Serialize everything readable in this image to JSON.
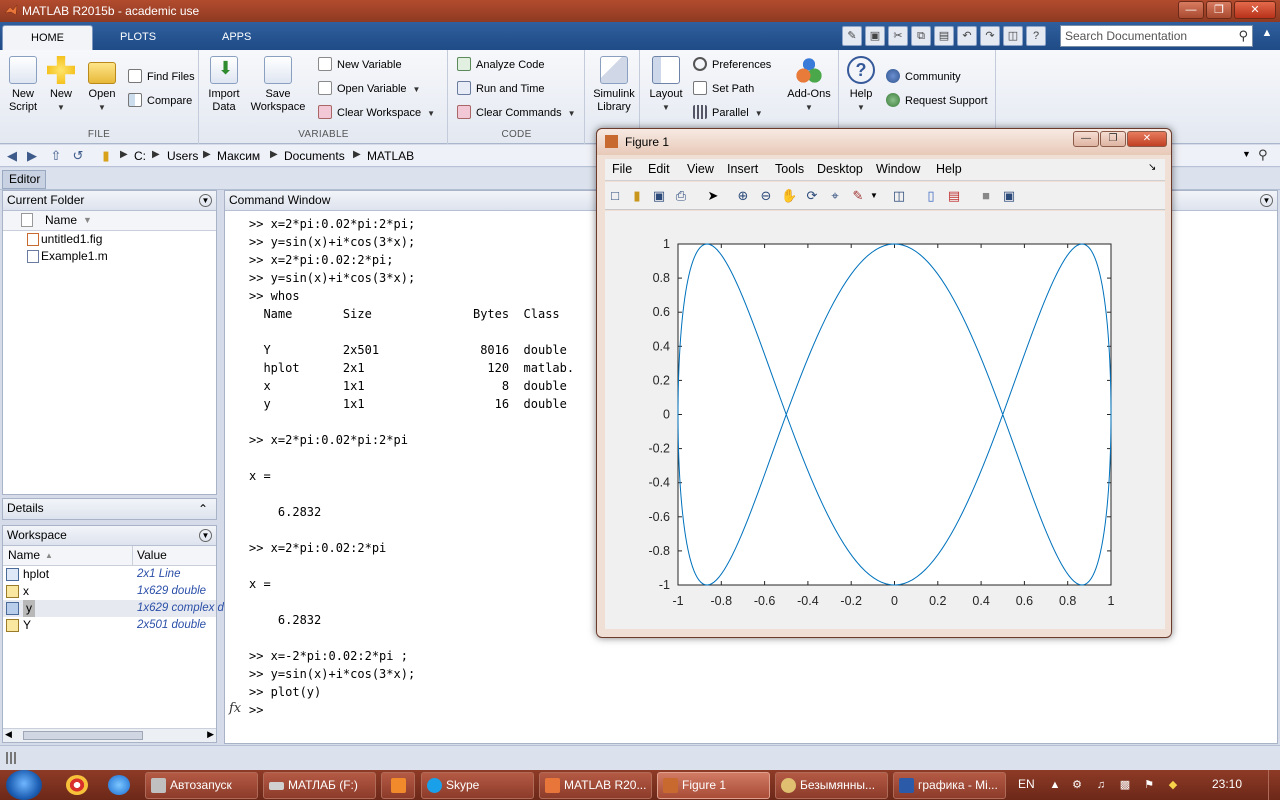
{
  "window": {
    "title": "MATLAB R2015b - academic use"
  },
  "tabs": [
    {
      "label": "HOME"
    },
    {
      "label": "PLOTS"
    },
    {
      "label": "APPS"
    }
  ],
  "search": {
    "placeholder": "Search Documentation"
  },
  "ribbon": {
    "file": {
      "label": "FILE",
      "new_script": [
        "New",
        "Script"
      ],
      "new": "New",
      "open": "Open",
      "find_files": "Find Files",
      "compare": "Compare"
    },
    "variable": {
      "label": "VARIABLE",
      "import_data": [
        "Import",
        "Data"
      ],
      "save_workspace": [
        "Save",
        "Workspace"
      ],
      "new_variable": "New Variable",
      "open_variable": "Open Variable",
      "clear_workspace": "Clear Workspace"
    },
    "code": {
      "label": "CODE",
      "analyze_code": "Analyze Code",
      "run_and_time": "Run and Time",
      "clear_commands": "Clear Commands"
    },
    "simulink": [
      "Simulink",
      "Library"
    ],
    "environment": {
      "layout": "Layout",
      "preferences": "Preferences",
      "set_path": "Set Path",
      "parallel": "Parallel",
      "addons": "Add-Ons"
    },
    "resources": {
      "help": "Help",
      "community": "Community",
      "request_support": "Request Support"
    }
  },
  "address": {
    "path": [
      "C:",
      "Users",
      "Максим",
      "Documents",
      "MATLAB"
    ]
  },
  "editor_tab": "Editor",
  "current_folder": {
    "title": "Current Folder",
    "column_name": "Name",
    "files": [
      {
        "name": "untitled1.fig"
      },
      {
        "name": "Example1.m"
      }
    ]
  },
  "details": {
    "title": "Details"
  },
  "workspace": {
    "title": "Workspace",
    "col_name": "Name",
    "col_value": "Value",
    "vars": [
      {
        "name": "hplot",
        "value": "2x1 Line"
      },
      {
        "name": "x",
        "value": "1x629 double"
      },
      {
        "name": "y",
        "value": "1x629 complex d"
      },
      {
        "name": "Y",
        "value": "2x501 double"
      }
    ]
  },
  "command_window": {
    "title": "Command Window",
    "lines": [
      ">> x=2*pi:0.02*pi:2*pi;",
      ">> y=sin(x)+i*cos(3*x);",
      ">> x=2*pi:0.02:2*pi;",
      ">> y=sin(x)+i*cos(3*x);",
      ">> whos",
      "  Name       Size              Bytes  Class",
      "",
      "  Y          2x501              8016  double",
      "  hplot      2x1                 120  matlab.",
      "  x          1x1                   8  double",
      "  y          1x1                  16  double",
      "",
      ">> x=2*pi:0.02*pi:2*pi",
      "",
      "x =",
      "",
      "    6.2832",
      "",
      ">> x=2*pi:0.02:2*pi",
      "",
      "x =",
      "",
      "    6.2832",
      "",
      ">> x=-2*pi:0.02:2*pi ;",
      ">> y=sin(x)+i*cos(3*x);",
      ">> plot(y)",
      ">>"
    ],
    "fx": "fx"
  },
  "figure": {
    "title": "Figure 1",
    "menu": [
      "File",
      "Edit",
      "View",
      "Insert",
      "Tools",
      "Desktop",
      "Window",
      "Help"
    ]
  },
  "chart_data": {
    "type": "line",
    "function": "plot(sin(x) + i*cos(3*x)), x = -2*pi:0.02:2*pi",
    "x_range": [
      -6.2832,
      6.2832
    ],
    "x_step": 0.02,
    "series": [
      {
        "real": "sin(x)",
        "imag": "cos(3*x)",
        "color": "#0072bd"
      }
    ],
    "xlim": [
      -1,
      1
    ],
    "ylim": [
      -1,
      1
    ],
    "xticks": [
      "-1",
      "-0.8",
      "-0.6",
      "-0.4",
      "-0.2",
      "0",
      "0.2",
      "0.4",
      "0.6",
      "0.8",
      "1"
    ],
    "yticks": [
      "1",
      "0.8",
      "0.6",
      "0.4",
      "0.2",
      "0",
      "-0.2",
      "-0.4",
      "-0.6",
      "-0.8",
      "-1"
    ],
    "grid": false
  },
  "taskbar": {
    "tasks": [
      {
        "label": "Автозапуск"
      },
      {
        "label": "МАТЛАБ (F:)"
      },
      {
        "label": ""
      },
      {
        "label": "Skype"
      },
      {
        "label": "MATLAB R20..."
      },
      {
        "label": "Figure 1"
      },
      {
        "label": "Безымянны..."
      },
      {
        "label": "графика - Mi..."
      }
    ],
    "lang": "EN",
    "clock": "23:10"
  },
  "colors": {
    "titlebar": "#9a4028",
    "ribbon_tabs": "#24508c",
    "plot_line": "#0072bd"
  }
}
